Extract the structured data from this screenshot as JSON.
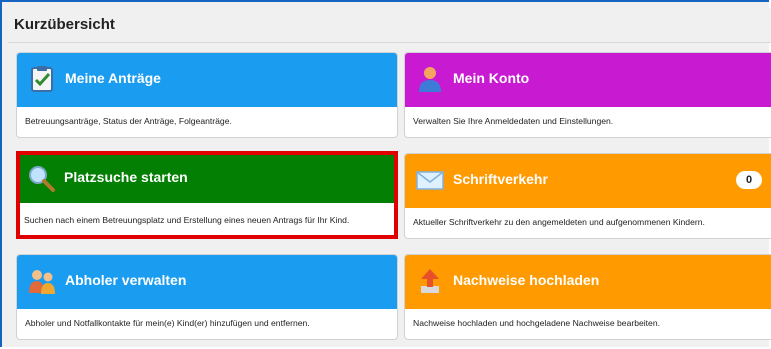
{
  "header": {
    "title": "Kurzübersicht"
  },
  "tiles": [
    {
      "title": "Meine Anträge",
      "desc": "Betreuungsanträge, Status der Anträge, Folgeanträge.",
      "color": "#1a9cf0",
      "icon": "clipboard-check-icon"
    },
    {
      "title": "Mein Konto",
      "desc": "Verwalten Sie Ihre Anmeldedaten und Einstellungen.",
      "color": "#c81ad0",
      "icon": "user-profile-icon"
    },
    {
      "title": "Platzsuche starten",
      "desc": "Suchen nach einem Betreuungsplatz und Erstellung eines neuen Antrags für Ihr Kind.",
      "color": "#038003",
      "icon": "magnifier-icon"
    },
    {
      "title": "Schriftverkehr",
      "desc": "Aktueller Schriftverkehr zu den angemeldeten und aufgenommenen Kindern.",
      "color": "#ff9a00",
      "icon": "envelope-icon",
      "badge": "0"
    },
    {
      "title": "Abholer verwalten",
      "desc": "Abholer und Notfallkontakte für mein(e) Kind(er) hinzufügen und entfernen.",
      "color": "#1a9cf0",
      "icon": "people-icon"
    },
    {
      "title": "Nachweise hochladen",
      "desc": "Nachweise hochladen und hochgeladene Nachweise bearbeiten.",
      "color": "#ff9a00",
      "icon": "upload-arrow-icon"
    }
  ]
}
